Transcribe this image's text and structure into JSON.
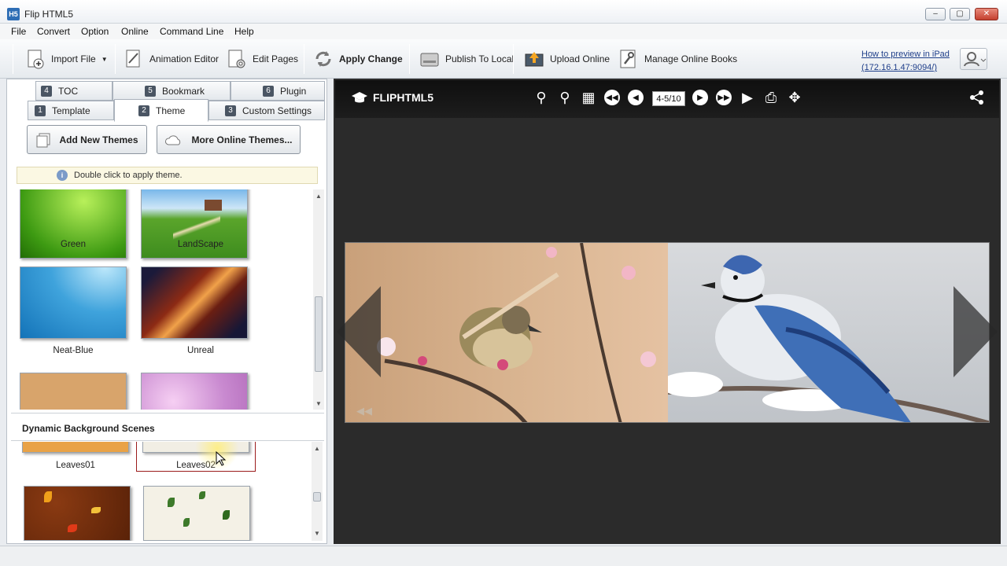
{
  "window": {
    "title": "Flip HTML5",
    "app_icon": "H5"
  },
  "menu": [
    "File",
    "Convert",
    "Option",
    "Online",
    "Command Line",
    "Help"
  ],
  "toolbar": {
    "import_file": "Import File",
    "animation_editor": "Animation Editor",
    "edit_pages": "Edit Pages",
    "apply_change": "Apply Change",
    "publish_local": "Publish To Local",
    "upload_online": "Upload Online",
    "manage_online": "Manage Online Books",
    "preview_line1": "How to preview in iPad",
    "preview_line2": "(172.16.1.47:9094/)"
  },
  "tabs": {
    "toc": {
      "num": "4",
      "label": "TOC"
    },
    "bookmark": {
      "num": "5",
      "label": "Bookmark"
    },
    "plugin": {
      "num": "6",
      "label": "Plugin"
    },
    "template": {
      "num": "1",
      "label": "Template"
    },
    "theme": {
      "num": "2",
      "label": "Theme"
    },
    "custom": {
      "num": "3",
      "label": "Custom Settings"
    }
  },
  "theme_panel": {
    "add_new": "Add New Themes",
    "more_online": "More Online Themes...",
    "hint": "Double click to apply theme.",
    "themes": [
      "Green",
      "LandScape",
      "Neat-Blue",
      "Unreal"
    ]
  },
  "dynamic": {
    "header": "Dynamic Background Scenes",
    "scenes": [
      "Leaves01",
      "Leaves02"
    ]
  },
  "viewer": {
    "logo": "FLIPHTML5",
    "page_indicator": "4-5/10"
  }
}
